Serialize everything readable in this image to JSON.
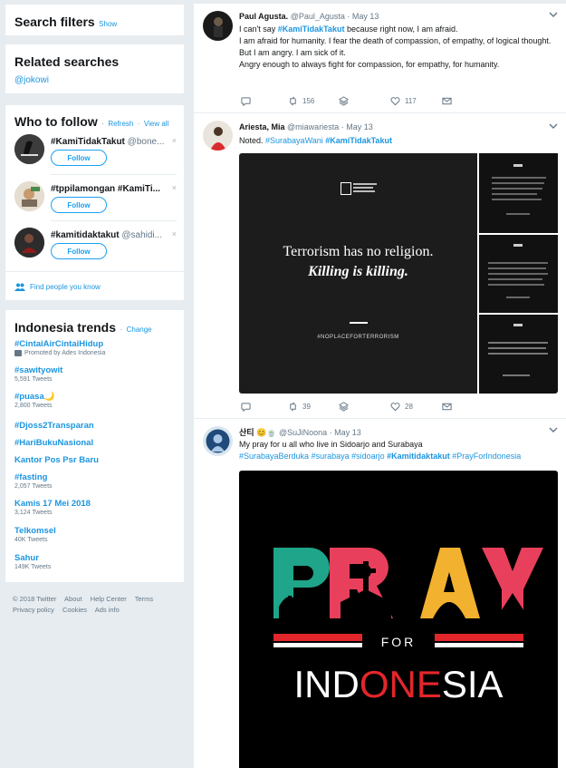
{
  "search_filters": {
    "title": "Search filters",
    "show": "Show"
  },
  "related": {
    "title": "Related searches",
    "items": [
      "@jokowi"
    ]
  },
  "who_to_follow": {
    "title": "Who to follow",
    "refresh": "Refresh",
    "dot": "·",
    "view_all": "View all",
    "users": [
      {
        "name": "#KamiTidakTakut",
        "handle": "@bone..."
      },
      {
        "name": "#tppilamongan #KamiTi...",
        "handle": ""
      },
      {
        "name": "#kamitidaktakut",
        "handle": "@sahidi..."
      }
    ],
    "follow_label": "Follow",
    "dismiss": "×",
    "find_people": "Find people you know"
  },
  "trends": {
    "title": "Indonesia trends",
    "change": "Change",
    "items": [
      {
        "name": "#CintaiAirCintaiHidup",
        "sub": "Promoted by Ades Indonesia"
      },
      {
        "name": "#sawityowit",
        "sub": "5,591 Tweets"
      },
      {
        "name": "#puasa🌙",
        "sub": "2,800 Tweets"
      },
      {
        "name": "#Djoss2Transparan",
        "sub": ""
      },
      {
        "name": "#HariBukuNasional",
        "sub": ""
      },
      {
        "name": "Kantor Pos Psr Baru",
        "sub": ""
      },
      {
        "name": "#fasting",
        "sub": "2,057 Tweets"
      },
      {
        "name": "Kamis 17 Mei 2018",
        "sub": "3,124 Tweets"
      },
      {
        "name": "Telkomsel",
        "sub": "40K Tweets"
      },
      {
        "name": "Sahur",
        "sub": "149K Tweets"
      }
    ]
  },
  "footer": {
    "row1": [
      "© 2018 Twitter",
      "About",
      "Help Center",
      "Terms"
    ],
    "row2": [
      "Privacy policy",
      "Cookies",
      "Ads info"
    ]
  },
  "tweets": [
    {
      "name": "Paul Agusta.",
      "handle": "@Paul_Agusta",
      "date": "· May 13",
      "line1_pre": "I can't say ",
      "line1_hash": "#KamiTidakTakut",
      "line1_post": " because right now, I am afraid.",
      "line2": "I am afraid for humanity. I fear the death of compassion, of empathy, of logical thought.",
      "line3": "But I am angry. I am sick of it.",
      "line4": "Angry enough to always fight for compassion, for empathy, for humanity.",
      "retweets": "156",
      "likes": "117"
    },
    {
      "name": "Ariesta, Mia",
      "handle": "@miawariesta",
      "date": "· May 13",
      "text_pre": "Noted. ",
      "hash1": "#SurabayaWani",
      "hash2": "#KamiTidakTakut",
      "image": {
        "line1": "Terrorism has no religion.",
        "line2": "Killing is killing.",
        "tag": "#NOPLACEFORTERRORISM"
      },
      "retweets": "39",
      "likes": "28"
    },
    {
      "name": "산티 😊🍵",
      "handle": "@SuJiNoona",
      "date": "· May 13",
      "text": "My pray for u all who live in Sidoarjo and Surabaya",
      "hashtags": [
        "#SurabayaBerduka",
        "#surabaya",
        "#sidoarjo",
        "#Kamitidaktakut",
        "#PrayForIndonesia"
      ],
      "poster": {
        "word1": "PRAY",
        "for": "FOR",
        "word2a": "IND",
        "word2b": "ONE",
        "word2c": "SIA"
      }
    }
  ],
  "colors": {
    "link": "#1b95e0",
    "bg": "#e6ecf0",
    "pray_green": "#1ea58a",
    "pray_orange": "#f2b12e",
    "pray_pink": "#e8405c",
    "red": "#e3262b"
  }
}
